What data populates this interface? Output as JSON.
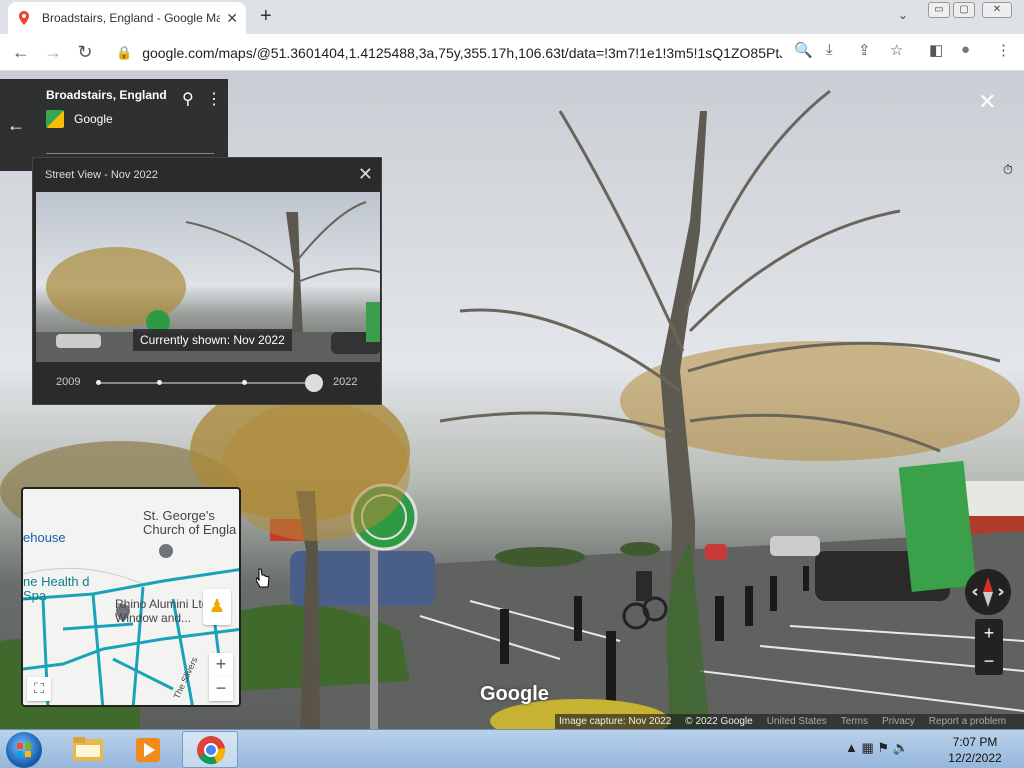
{
  "browser": {
    "tab_title": "Broadstairs, England - Google Ma",
    "url": "google.com/maps/@51.3601404,1.4125488,3a,75y,355.17h,106.63t/data=!3m7!1e1!3m5!1sQ1ZO85PtJ...",
    "new_tab": "+",
    "tab_close": "✕",
    "tab_list": "⌄"
  },
  "window_controls": {
    "minimize": "▭",
    "maximize": "▢",
    "close": "✕"
  },
  "nav": {
    "back": "←",
    "forward": "→",
    "reload": "↻"
  },
  "omnibox_icons": {
    "lock": "🔒",
    "search": "🔍",
    "install": "⤓",
    "share": "⇪",
    "star": "☆",
    "sidebar": "◧",
    "profile": "●",
    "menu": "⋮"
  },
  "info_card": {
    "place": "Broadstairs, England",
    "brand": "Google",
    "sv_label": "Street View - Nov 2022",
    "back": "←",
    "pin": "⚲",
    "more": "⋮"
  },
  "time_machine": {
    "header": "Street View - Nov 2022",
    "clock": "⏱",
    "close": "✕",
    "currently_shown": "Currently shown: Nov 2022",
    "start_year": "2009",
    "end_year": "2022"
  },
  "scene_close": "✕",
  "minimap": {
    "church_label": "St. George's Church of Engla",
    "house_label": "ehouse",
    "health_label": "ne Health d Spa",
    "rhino_label": "Rhino Alumini Ltd. Window and...",
    "road_label": "The Slivers",
    "zoom_in": "+",
    "zoom_out": "−",
    "fullscreen": "⛶",
    "pegman": "♟"
  },
  "zoom": {
    "in": "+",
    "out": "−"
  },
  "watermark": "Google",
  "footer": {
    "capture": "Image capture: Nov 2022",
    "copyright": "© 2022 Google",
    "region": "United States",
    "terms": "Terms",
    "privacy": "Privacy",
    "report": "Report a problem"
  },
  "taskbar": {
    "time": "7:07 PM",
    "date": "12/2/2022",
    "tray_icons": "▲ ▦ ⚑ 🔊"
  }
}
